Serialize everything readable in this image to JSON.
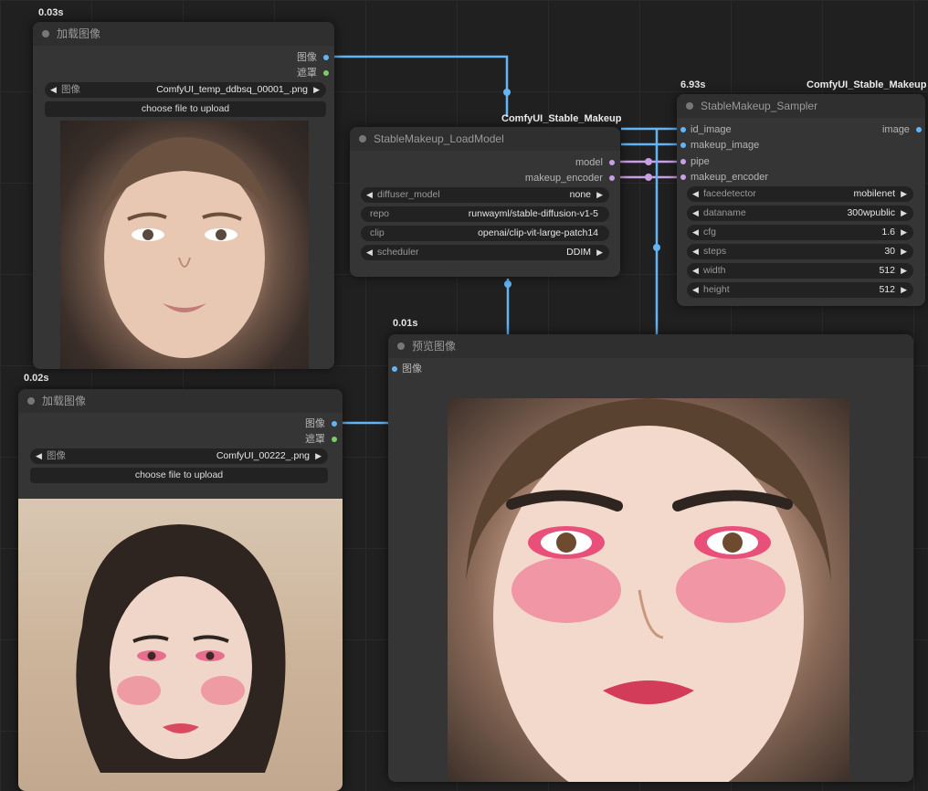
{
  "timings": {
    "load_image_1": "0.03s",
    "load_image_2": "0.02s",
    "sampler": "6.93s",
    "preview": "0.01s"
  },
  "wire_labels": {
    "load_model": "ComfyUI_Stable_Makeup",
    "sampler": "ComfyUI_Stable_Makeup"
  },
  "load_image_1": {
    "title": "加载图像",
    "outputs": [
      "图像",
      "遮罩"
    ],
    "image_label": "图像",
    "image_value": "ComfyUI_temp_ddbsq_00001_.png",
    "upload_label": "choose file to upload"
  },
  "load_image_2": {
    "title": "加载图像",
    "outputs": [
      "图像",
      "遮罩"
    ],
    "image_label": "图像",
    "image_value": "ComfyUI_00222_.png",
    "upload_label": "choose file to upload"
  },
  "load_model": {
    "title": "StableMakeup_LoadModel",
    "outputs": [
      "model",
      "makeup_encoder"
    ],
    "widgets": [
      {
        "label": "diffuser_model",
        "value": "none"
      },
      {
        "label": "repo",
        "value": "runwayml/stable-diffusion-v1-5"
      },
      {
        "label": "clip",
        "value": "openai/clip-vit-large-patch14"
      },
      {
        "label": "scheduler",
        "value": "DDIM"
      }
    ]
  },
  "sampler": {
    "title": "StableMakeup_Sampler",
    "inputs": [
      "id_image",
      "makeup_image",
      "pipe",
      "makeup_encoder"
    ],
    "output": "image",
    "widgets": [
      {
        "label": "facedetector",
        "value": "mobilenet"
      },
      {
        "label": "dataname",
        "value": "300wpublic"
      },
      {
        "label": "cfg",
        "value": "1.6"
      },
      {
        "label": "steps",
        "value": "30"
      },
      {
        "label": "width",
        "value": "512"
      },
      {
        "label": "height",
        "value": "512"
      }
    ]
  },
  "preview": {
    "title": "预览图像",
    "input": "图像"
  },
  "colors": {
    "image_wire": "#64b5f6",
    "mask_dot": "#7ccd6a",
    "model_wire": "#c8a0e8",
    "node_bg": "#353535",
    "canvas_bg": "#202020"
  },
  "icons": [
    "arrow-left-icon",
    "arrow-right-icon",
    "node-collapse-dot-icon",
    "slot-dot-icon"
  ]
}
